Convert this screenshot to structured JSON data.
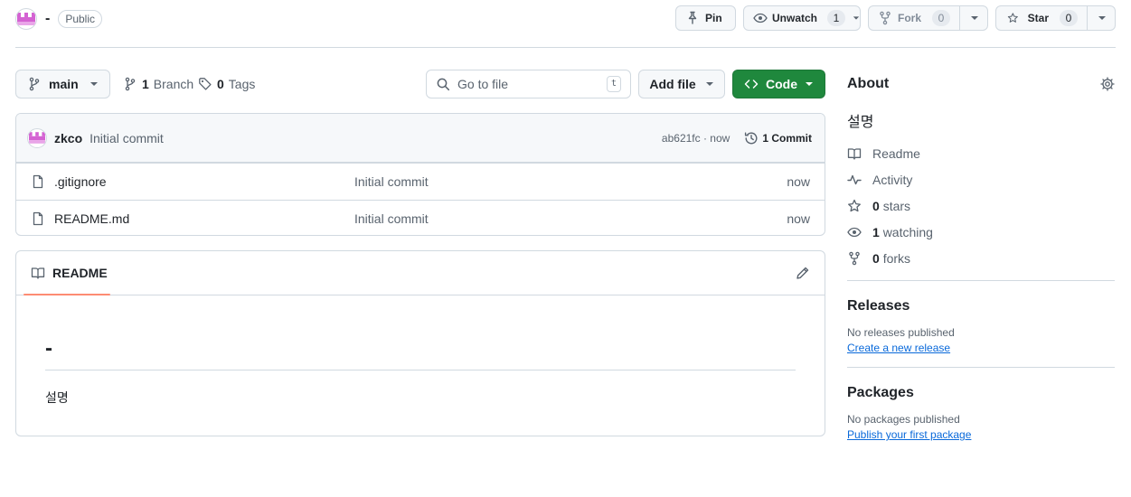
{
  "repo": {
    "name": "-",
    "visibility": "Public"
  },
  "header_actions": {
    "pin": "Pin",
    "unwatch": "Unwatch",
    "unwatch_count": "1",
    "fork": "Fork",
    "fork_count": "0",
    "star": "Star",
    "star_count": "0"
  },
  "toolbar": {
    "branch": "main",
    "branches_count": "1",
    "branches_label": "Branch",
    "tags_count": "0",
    "tags_label": "Tags",
    "search_placeholder": "Go to file",
    "search_kbd": "t",
    "add_file": "Add file",
    "code": "Code"
  },
  "latest_commit": {
    "author": "zkco",
    "message": "Initial commit",
    "hash_time": "ab621fc · now",
    "commits_label": "1 Commit"
  },
  "files": [
    {
      "name": ".gitignore",
      "message": "Initial commit",
      "time": "now"
    },
    {
      "name": "README.md",
      "message": "Initial commit",
      "time": "now"
    }
  ],
  "readme": {
    "tab": "README",
    "heading": "-",
    "paragraph": "설명"
  },
  "about": {
    "title": "About",
    "description": "설명",
    "readme": "Readme",
    "activity": "Activity",
    "stars_count": "0",
    "stars_label": "stars",
    "watching_count": "1",
    "watching_label": "watching",
    "forks_count": "0",
    "forks_label": "forks"
  },
  "releases": {
    "title": "Releases",
    "note": "No releases published",
    "link": "Create a new release"
  },
  "packages": {
    "title": "Packages",
    "note": "No packages published",
    "link": "Publish your first package"
  },
  "colors": {
    "accent_green": "#1f883d",
    "link_blue": "#0969da",
    "tab_underline": "#fd8c73"
  }
}
